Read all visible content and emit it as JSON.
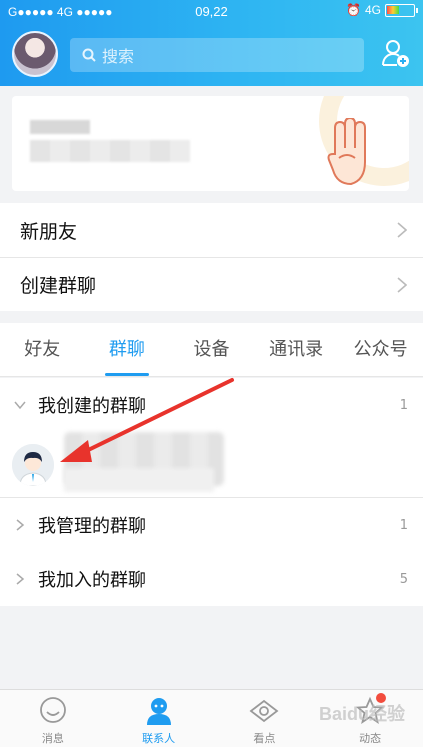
{
  "status": {
    "carrier_left": "G●●●●● 4G ●●●●●",
    "time": "09,22",
    "network_right": "4G"
  },
  "header": {
    "search_placeholder": "搜索"
  },
  "list": {
    "items": [
      {
        "label": "新朋友"
      },
      {
        "label": "创建群聊"
      }
    ]
  },
  "tabs": [
    {
      "label": "好友"
    },
    {
      "label": "群聊",
      "active": true
    },
    {
      "label": "设备"
    },
    {
      "label": "通讯录"
    },
    {
      "label": "公众号"
    }
  ],
  "groups": {
    "created": {
      "label": "我创建的群聊",
      "count": "1"
    },
    "managed": {
      "label": "我管理的群聊",
      "count": "1"
    },
    "joined": {
      "label": "我加入的群聊",
      "count": "5"
    }
  },
  "nav": {
    "items": [
      {
        "label": "消息"
      },
      {
        "label": "联系人"
      },
      {
        "label": "看点"
      },
      {
        "label": "动态"
      }
    ]
  },
  "watermark": "Baidu经验",
  "colors": {
    "accent": "#1f9cf0",
    "badge": "#f24c3d",
    "arrow": "#e8332c"
  },
  "icons": [
    "search-icon",
    "add-friend-icon",
    "chevron-right-icon",
    "chevron-down-icon",
    "message-icon",
    "contacts-icon",
    "eye-icon",
    "star-icon"
  ]
}
